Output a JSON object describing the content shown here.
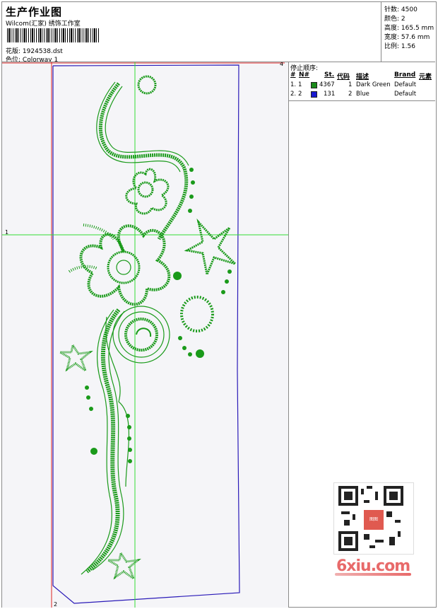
{
  "header": {
    "title": "生产作业图",
    "subtitle": "Wilcom(汇家)   绣饰工作室",
    "design_label": "花版:",
    "design_value": "1924538.dst",
    "colorway_label": "色位:",
    "colorway_value": "Colorway 1"
  },
  "stats": [
    {
      "label": "针数:",
      "value": "4500"
    },
    {
      "label": "颜色:",
      "value": "2"
    },
    {
      "label": "高度:",
      "value": "165.5 mm"
    },
    {
      "label": "宽度:",
      "value": "57.6 mm"
    },
    {
      "label": "比例:",
      "value": "1.56"
    }
  ],
  "stop_sequence": {
    "title": "停止顺序:",
    "headers": [
      "#",
      "N#",
      "St.",
      "代码",
      "描述",
      "Brand",
      "元素"
    ],
    "rows": [
      {
        "index": "1.",
        "needle": "1",
        "stitches": "4367",
        "code": "1",
        "description": "Dark Green",
        "brand": "Default",
        "color": "#1a8a1a"
      },
      {
        "index": "2.",
        "needle": "2",
        "stitches": "131",
        "code": "2",
        "description": "Blue",
        "brand": "Default",
        "color": "#1a1ad0"
      }
    ]
  },
  "canvas": {
    "marker_1": "1",
    "marker_2": "2",
    "marker_4": "4",
    "stitch_color": "#1a9a1a",
    "outline_color": "#2a1ab8",
    "guide_color": "#33dd33",
    "frame_red": "#dd2222"
  },
  "watermark": {
    "text": "6xiu.com",
    "logo_text": "图图"
  }
}
